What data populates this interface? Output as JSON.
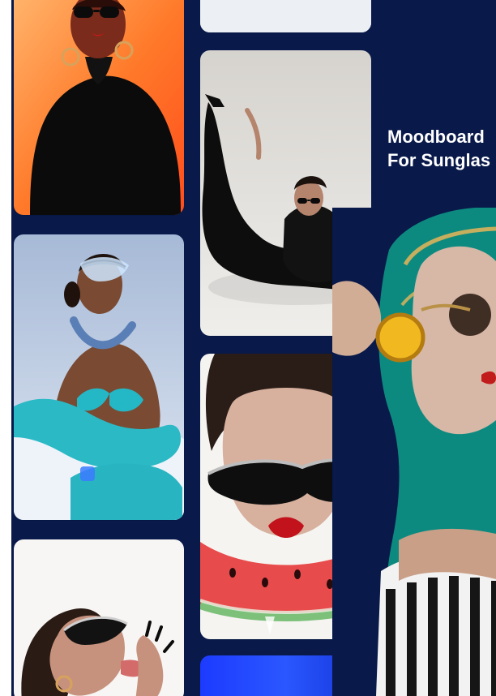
{
  "theme": {
    "background": "#08194a",
    "left_strip": "#ffffff"
  },
  "title": {
    "line1": "Moodboard",
    "line2": "For Sunglas"
  },
  "cards": [
    {
      "name": "card-orange-model",
      "icon": "photo-icon"
    },
    {
      "name": "card-pose-leg-up",
      "icon": "photo-icon"
    },
    {
      "name": "card-blue-gloves",
      "icon": "photo-icon"
    },
    {
      "name": "card-watermelon",
      "icon": "photo-icon"
    },
    {
      "name": "card-tongue-out",
      "icon": "photo-icon"
    },
    {
      "name": "card-blue-bottom",
      "icon": "photo-icon"
    },
    {
      "name": "card-top-blank",
      "icon": "photo-icon"
    },
    {
      "name": "card-scarf-model",
      "icon": "photo-icon"
    }
  ]
}
